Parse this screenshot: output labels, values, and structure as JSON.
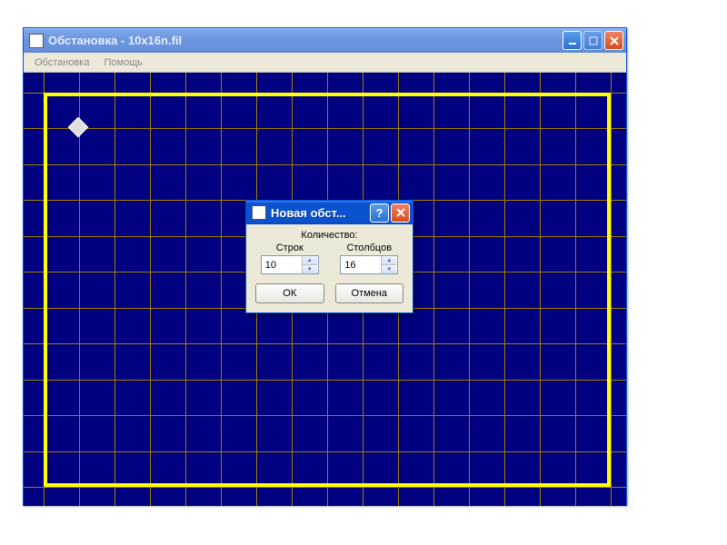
{
  "main_window": {
    "title": "Обстановка - 10x16n.fil",
    "menu": {
      "items": [
        "Обстановка",
        "Помощь"
      ]
    },
    "grid": {
      "rows": 12,
      "cols": 17,
      "boundary": {
        "top_row": 0,
        "left_col": 0,
        "width_cols": 16,
        "height_rows": 11
      },
      "robot": {
        "row": 1,
        "col": 1
      }
    }
  },
  "dialog": {
    "title": "Новая обст...",
    "qty_label": "Количество:",
    "rows_label": "Строк",
    "cols_label": "Столбцов",
    "rows_value": "10",
    "cols_value": "16",
    "ok_label": "ОК",
    "cancel_label": "Отмена"
  }
}
